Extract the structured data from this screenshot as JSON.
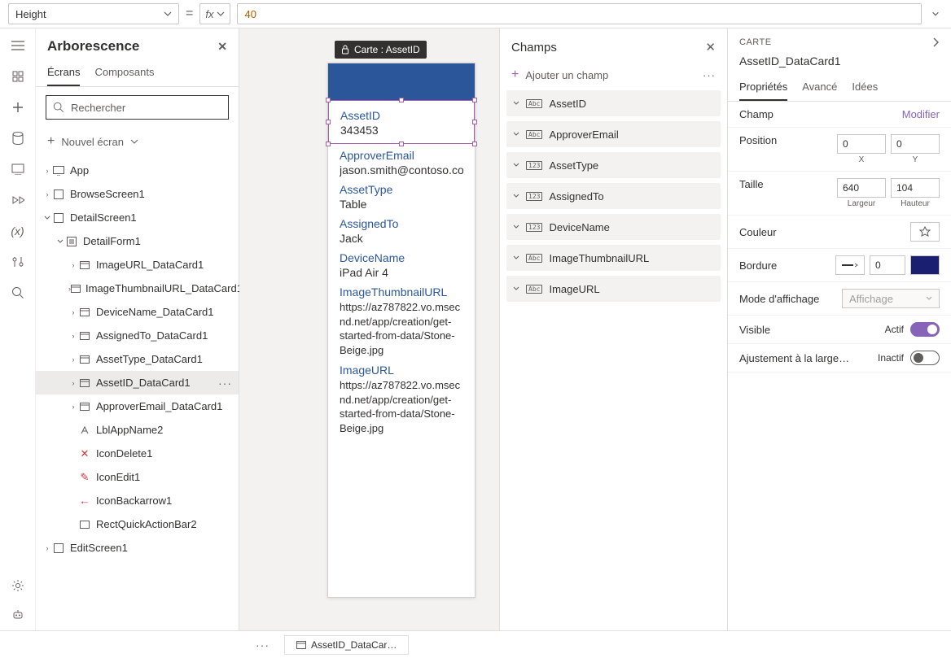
{
  "formula": {
    "property": "Height",
    "fx_label": "fx",
    "value": "40"
  },
  "tree": {
    "title": "Arborescence",
    "tabs": {
      "screens": "Écrans",
      "components": "Composants"
    },
    "search_placeholder": "Rechercher",
    "new_screen": "Nouvel écran",
    "app": "App",
    "browse": "BrowseScreen1",
    "detail": "DetailScreen1",
    "detail_form": "DetailForm1",
    "cards": {
      "imageurl": "ImageURL_DataCard1",
      "thumb": "ImageThumbnailURL_DataCard1",
      "device": "DeviceName_DataCard1",
      "assigned": "AssignedTo_DataCard1",
      "assettype": "AssetType_DataCard1",
      "assetid": "AssetID_DataCard1",
      "approver": "ApproverEmail_DataCard1"
    },
    "lblapp": "LblAppName2",
    "icondelete": "IconDelete1",
    "iconedit": "IconEdit1",
    "iconback": "IconBackarrow1",
    "rect": "RectQuickActionBar2",
    "edit": "EditScreen1"
  },
  "canvas": {
    "tooltip": "Carte : AssetID",
    "fields": {
      "assetid": {
        "label": "AssetID",
        "value": "343453"
      },
      "approver": {
        "label": "ApproverEmail",
        "value": "jason.smith@contoso.com"
      },
      "assettype": {
        "label": "AssetType",
        "value": "Table"
      },
      "assigned": {
        "label": "AssignedTo",
        "value": "Jack"
      },
      "device": {
        "label": "DeviceName",
        "value": "iPad Air 4"
      },
      "thumb": {
        "label": "ImageThumbnailURL",
        "value": "https://az787822.vo.msecnd.net/app/creation/get-started-from-data/Stone-Beige.jpg"
      },
      "imageurl": {
        "label": "ImageURL",
        "value": "https://az787822.vo.msecnd.net/app/creation/get-started-from-data/Stone-Beige.jpg"
      }
    }
  },
  "champs": {
    "title": "Champs",
    "add": "Ajouter un champ",
    "items": {
      "assetid": {
        "type": "Abc",
        "label": "AssetID"
      },
      "approver": {
        "type": "Abc",
        "label": "ApproverEmail"
      },
      "assettype": {
        "type": "123",
        "label": "AssetType"
      },
      "assigned": {
        "type": "123",
        "label": "AssignedTo"
      },
      "device": {
        "type": "123",
        "label": "DeviceName"
      },
      "thumb": {
        "type": "Abc",
        "label": "ImageThumbnailURL"
      },
      "imageurl": {
        "type": "Abc",
        "label": "ImageURL"
      }
    }
  },
  "props": {
    "head": "CARTE",
    "title": "AssetID_DataCard1",
    "tabs": {
      "properties": "Propriétés",
      "advanced": "Avancé",
      "ideas": "Idées"
    },
    "champ_label": "Champ",
    "modifier": "Modifier",
    "position_label": "Position",
    "pos_x": "0",
    "pos_y": "0",
    "x_label": "X",
    "y_label": "Y",
    "size_label": "Taille",
    "width": "640",
    "height": "104",
    "w_label": "Largeur",
    "h_label": "Hauteur",
    "color_label": "Couleur",
    "border_label": "Bordure",
    "border_width": "0",
    "mode_label": "Mode d'affichage",
    "mode_value": "Affichage",
    "visible_label": "Visible",
    "visible_state": "Actif",
    "fit_label": "Ajustement à la large…",
    "fit_state": "Inactif"
  },
  "bottom": {
    "tab": "AssetID_DataCar…"
  }
}
